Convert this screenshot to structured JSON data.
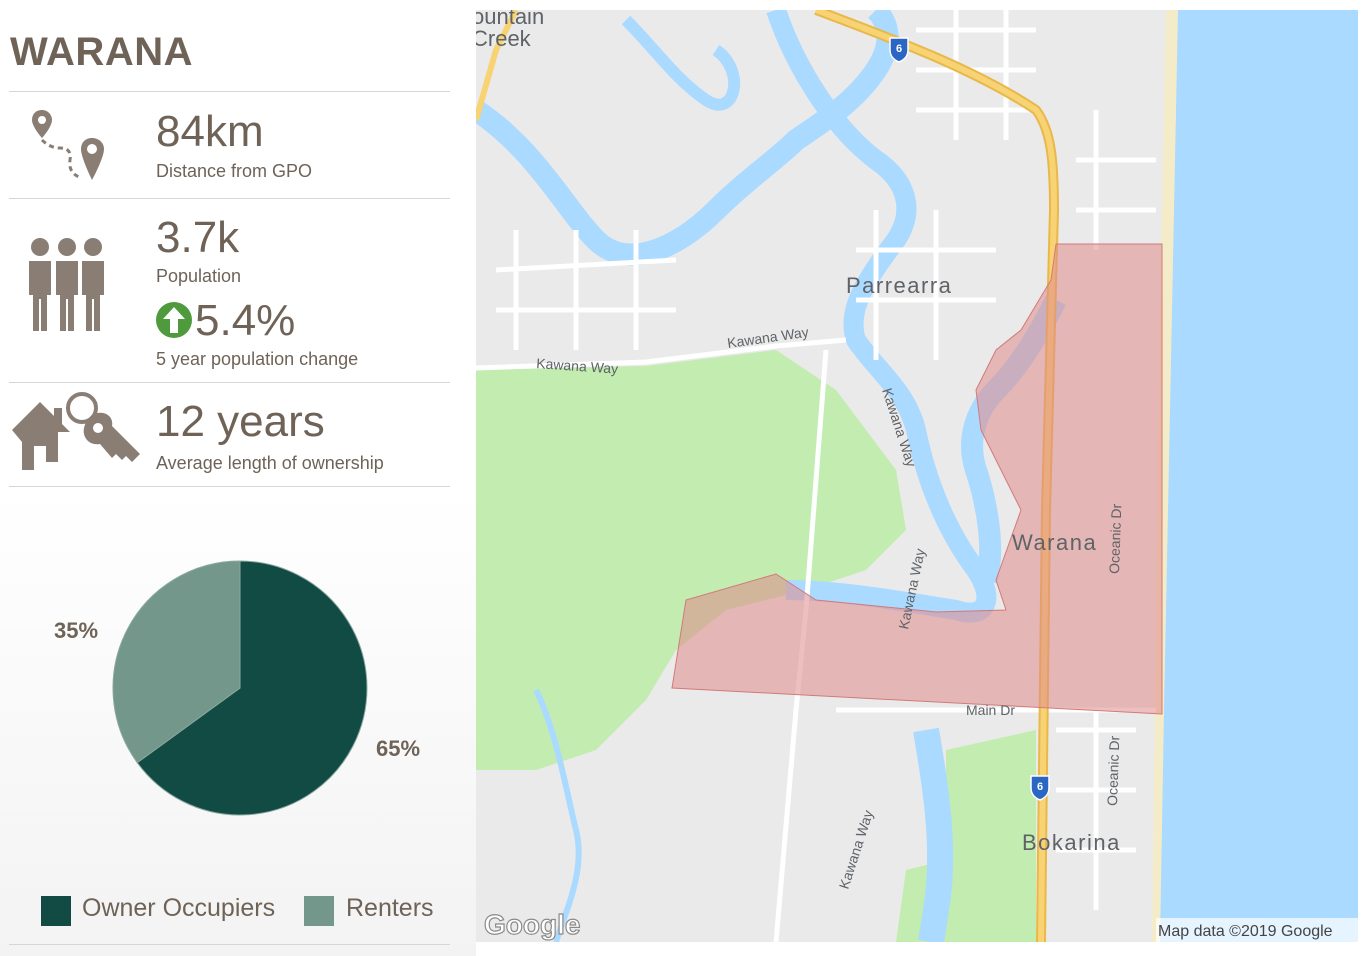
{
  "suburb": "WARANA",
  "stats": {
    "distance": {
      "value": "84km",
      "label": "Distance from GPO",
      "icon": "map-route-icon"
    },
    "population": {
      "value": "3.7k",
      "label": "Population",
      "icon": "people-icon"
    },
    "population_change": {
      "value": "5.4%",
      "label": "5 year population change",
      "icon": "up-arrow-icon",
      "direction": "up"
    },
    "ownership": {
      "value": "12 years",
      "label": "Average length of ownership",
      "icon": "house-key-icon"
    }
  },
  "chart_data": {
    "type": "pie",
    "slices": [
      {
        "label": "Owner Occupiers",
        "value": 65,
        "display": "65%",
        "color": "#124b44"
      },
      {
        "label": "Renters",
        "value": 35,
        "display": "35%",
        "color": "#73988b"
      }
    ],
    "legend": [
      "Owner Occupiers",
      "Renters"
    ],
    "legend_position": "bottom"
  },
  "map": {
    "labels": {
      "fountain_creek": "ountain\nCreek",
      "parrearra": "Parrearra",
      "warana": "Warana",
      "bokarina": "Bokarina",
      "kawana_way_1": "Kawana Way",
      "kawana_way_2": "Kawana Way",
      "kawana_way_3": "Kawana Way",
      "kawana_way_4": "Kawana Way",
      "kawana_way_5": "Kawana Way",
      "oceanic_dr_1": "Oceanic Dr",
      "oceanic_dr_2": "Oceanic Dr",
      "main_dr": "Main Dr",
      "route_shield": "6",
      "google_logo": "Google",
      "attribution": "Map data ©2019 Google"
    },
    "colors": {
      "water": "#aadaff",
      "land": "#eaeaea",
      "park": "#c2ecb0",
      "highway": "#f8c85a",
      "highlight": "#e08a8a"
    }
  }
}
